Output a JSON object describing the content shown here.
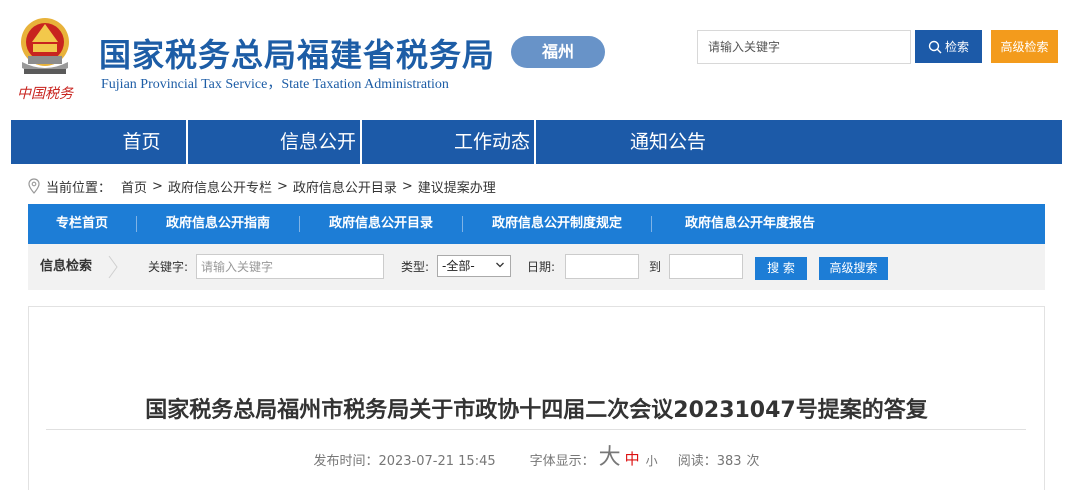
{
  "header": {
    "title": "国家税务总局福建省税务局",
    "subtitle": "Fujian Provincial Tax Service，State Taxation Administration",
    "emblem_caption": "中国税务",
    "city": "福州",
    "search": {
      "placeholder": "请输入关键字",
      "button": "检索"
    },
    "advanced_search": "高级检索",
    "colors": {
      "brand_blue": "#1c5aa8",
      "orange": "#f39b1c"
    }
  },
  "main_nav": {
    "items": [
      {
        "label": "首页"
      },
      {
        "label": "信息公开"
      },
      {
        "label": "工作动态"
      },
      {
        "label": "通知公告"
      }
    ]
  },
  "breadcrumb": {
    "prefix": "当前位置：",
    "items": [
      "首页",
      "政府信息公开专栏",
      "政府信息公开目录",
      "建议提案办理"
    ],
    "separator": ">"
  },
  "sub_nav": {
    "items": [
      {
        "label": "专栏首页"
      },
      {
        "label": "政府信息公开指南"
      },
      {
        "label": "政府信息公开目录"
      },
      {
        "label": "政府信息公开制度规定"
      },
      {
        "label": "政府信息公开年度报告"
      }
    ]
  },
  "filter": {
    "title": "信息检索",
    "keyword_label": "关键字:",
    "keyword_placeholder": "请输入关键字",
    "type_label": "类型:",
    "type_selected": "-全部-",
    "date_label": "日期:",
    "to_label": "到",
    "search_button": "搜 索",
    "advanced_button": "高级搜索"
  },
  "article": {
    "title": "国家税务总局福州市税务局关于市政协十四届二次会议20231047号提案的答复",
    "publish_label": "发布时间：",
    "publish_time": "2023-07-21 15:45",
    "font_label": "字体显示：",
    "font_large": "大",
    "font_medium": "中",
    "font_small": "小",
    "read_label": "阅读：",
    "read_count": "383",
    "read_unit": "次"
  }
}
